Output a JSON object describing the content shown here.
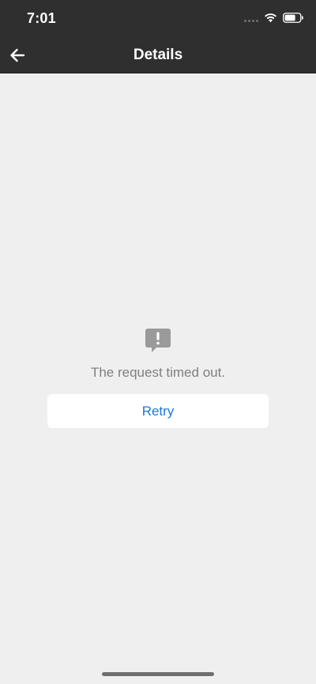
{
  "status_bar": {
    "time": "7:01"
  },
  "nav": {
    "title": "Details",
    "back_icon": "arrow-left-icon"
  },
  "error": {
    "icon": "alert-bubble-icon",
    "message": "The request timed out.",
    "retry_label": "Retry"
  },
  "colors": {
    "nav_background": "#2f2f2f",
    "page_background": "#efefef",
    "accent": "#1f76d8",
    "muted_text": "#7f7f7f"
  }
}
